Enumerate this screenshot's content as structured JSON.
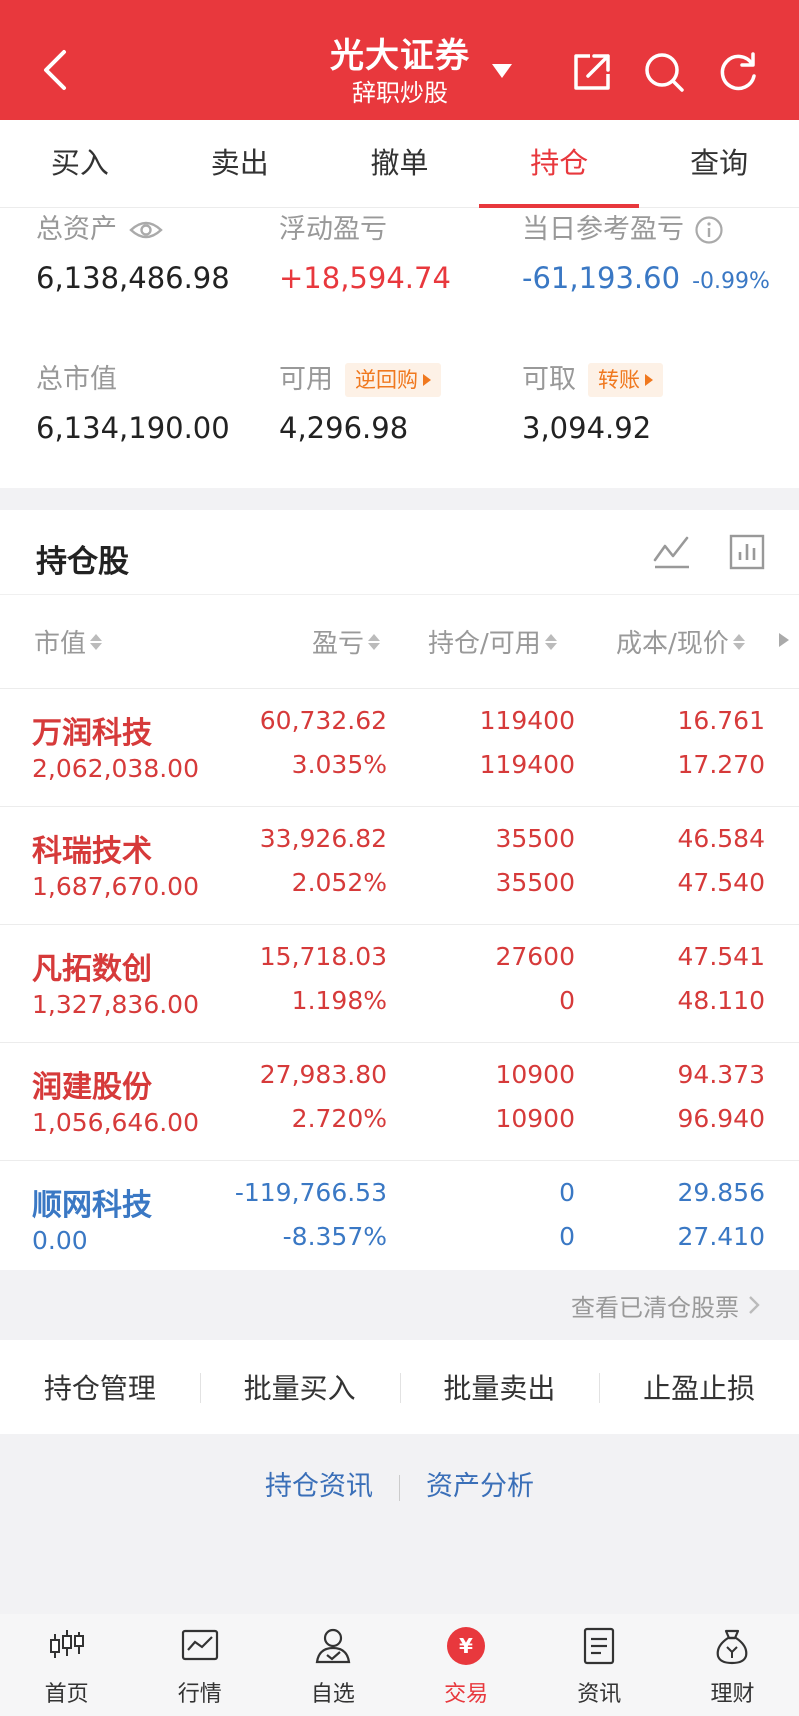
{
  "header": {
    "title": "光大证券",
    "subtitle": "辞职炒股"
  },
  "tabs": [
    "买入",
    "卖出",
    "撤单",
    "持仓",
    "查询"
  ],
  "active_tab": "持仓",
  "summary": {
    "total_assets_label": "总资产",
    "total_assets": "6,138,486.98",
    "floating_pl_label": "浮动盈亏",
    "floating_pl": "+18,594.74",
    "daily_pl_label": "当日参考盈亏",
    "daily_pl": "-61,193.60",
    "daily_pl_pct": "-0.99%",
    "market_value_label": "总市值",
    "market_value": "6,134,190.00",
    "available_label": "可用",
    "available": "4,296.98",
    "reverse_repo_label": "逆回购",
    "withdrawable_label": "可取",
    "withdrawable": "3,094.92",
    "transfer_label": "转账"
  },
  "holdings": {
    "title": "持仓股",
    "columns": [
      "市值",
      "盈亏",
      "持仓/可用",
      "成本/现价"
    ],
    "rows": [
      {
        "name": "万润科技",
        "market_value": "2,062,038.00",
        "pl": "60,732.62",
        "pl_pct": "3.035%",
        "position": "119400",
        "available": "119400",
        "cost": "16.761",
        "price": "17.270",
        "color": "red"
      },
      {
        "name": "科瑞技术",
        "market_value": "1,687,670.00",
        "pl": "33,926.82",
        "pl_pct": "2.052%",
        "position": "35500",
        "available": "35500",
        "cost": "46.584",
        "price": "47.540",
        "color": "red"
      },
      {
        "name": "凡拓数创",
        "market_value": "1,327,836.00",
        "pl": "15,718.03",
        "pl_pct": "1.198%",
        "position": "27600",
        "available": "0",
        "cost": "47.541",
        "price": "48.110",
        "color": "red"
      },
      {
        "name": "润建股份",
        "market_value": "1,056,646.00",
        "pl": "27,983.80",
        "pl_pct": "2.720%",
        "position": "10900",
        "available": "10900",
        "cost": "94.373",
        "price": "96.940",
        "color": "red"
      },
      {
        "name": "顺网科技",
        "market_value": "0.00",
        "pl": "-119,766.53",
        "pl_pct": "-8.357%",
        "position": "0",
        "available": "0",
        "cost": "29.856",
        "price": "27.410",
        "color": "blue"
      }
    ],
    "cleared_link": "查看已清仓股票"
  },
  "actions": [
    "持仓管理",
    "批量买入",
    "批量卖出",
    "止盈止损"
  ],
  "links": [
    "持仓资讯",
    "资产分析"
  ],
  "bottom_nav": [
    "首页",
    "行情",
    "自选",
    "交易",
    "资讯",
    "理财"
  ],
  "colors": {
    "brand_red": "#e8383d",
    "loss_blue": "#3a78c4",
    "orange": "#f0781e"
  }
}
